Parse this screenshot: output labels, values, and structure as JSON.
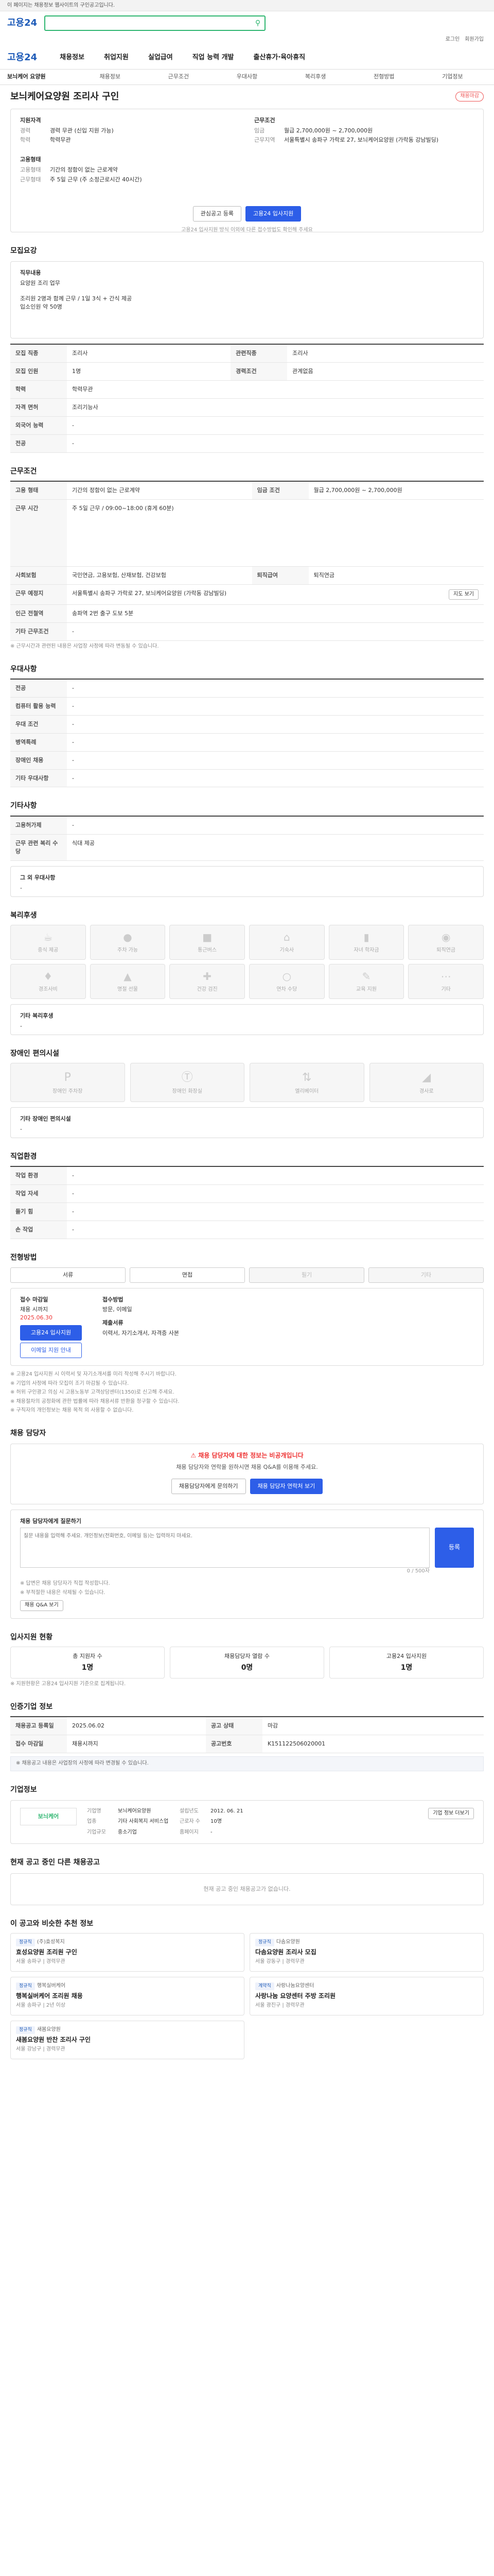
{
  "topbar": {
    "text": "이 페이지는 채용정보 웹사이트의 구인공고입니다."
  },
  "brand": {
    "logo": "고용24"
  },
  "util": [
    "로그인",
    "회원가입"
  ],
  "gnb": [
    "채용정보",
    "취업지원",
    "실업급여",
    "직업 능력 개발",
    "출산휴가·육아휴직"
  ],
  "tabs": [
    "채용정보",
    "근무조건",
    "우대사항",
    "복리후생",
    "전형방법",
    "기업정보"
  ],
  "job": {
    "company": "보늬케어 요양원",
    "title": "보늬케어요양원 조리사 구인",
    "badge": "채용마감",
    "left_label": "지원자격",
    "left_rows": [
      {
        "k": "경력",
        "v": "경력 무관 (신입 지원 가능)"
      },
      {
        "k": "학력",
        "v": "학력무관"
      }
    ],
    "right_label": "근무조건",
    "right_rows": [
      {
        "k": "임금",
        "v": "월급 2,700,000원 ~ 2,700,000원"
      },
      {
        "k": "근무지역",
        "v": "서울특별시 송파구 가락로 27, 보늬케어요양원 (가락동 강남빌딩)"
      }
    ],
    "left2_label": "고용형태",
    "left2_rows": [
      {
        "k": "고용형태",
        "v": "기간의 정함이 없는 근로계약"
      },
      {
        "k": "근무형태",
        "v": "주 5일 근무 (주 소정근로시간 40시간)"
      }
    ],
    "btn_scrap": "관심공고 등록",
    "btn_apply": "고용24 입사지원",
    "foot": "고용24 입사지원 방식 이외에 다른 접수방법도 확인해 주세요"
  },
  "summary": {
    "title": "모집요강",
    "duty_label": "직무내용",
    "duty": "요양원 조리 업무",
    "duty2": "조리원 2명과 함께 근무 / 1일 3식 + 간식 제공",
    "duty3": "입소인원 약 50명",
    "rows": [
      {
        "k": "모집 직종",
        "v": "조리사",
        "k2": "관련직종",
        "v2": "조리사"
      },
      {
        "k": "모집 인원",
        "v": "1명",
        "k2": "경력조건",
        "v2": "관계없음"
      },
      {
        "k": "학력",
        "v": "학력무관",
        "k2": "",
        "v2": ""
      },
      {
        "k": "자격 면허",
        "v": "조리기능사",
        "k2": "",
        "v2": ""
      },
      {
        "k": "외국어 능력",
        "v": "-",
        "k2": "",
        "v2": ""
      },
      {
        "k": "전공",
        "v": "-",
        "k2": "",
        "v2": ""
      }
    ]
  },
  "conditions": {
    "title": "근무조건",
    "rows": [
      {
        "k": "고용 형태",
        "v": "기간의 정함이 없는 근로계약",
        "k2": "임금 조건",
        "v2": "월급 2,700,000원 ~ 2,700,000원"
      },
      {
        "k": "근무 시간",
        "v": "주 5일 근무 / 09:00~18:00 (휴게 60분)",
        "k2": "",
        "v2": ""
      },
      {
        "k": "사회보험",
        "v": "국민연금, 고용보험, 산재보험, 건강보험",
        "k2": "퇴직급여",
        "v2": "퇴직연금"
      },
      {
        "k": "근무 예정지",
        "v": "서울특별시 송파구 가락로 27, 보늬케어요양원 (가락동 강남빌딩)",
        "k2": "",
        "v2": ""
      },
      {
        "k": "인근 전철역",
        "v": "송파역 2번 출구 도보 5분",
        "k2": "",
        "v2": ""
      },
      {
        "k": "기타 근무조건",
        "v": "-",
        "k2": "",
        "v2": ""
      }
    ],
    "map_btn": "지도 보기",
    "note": "※ 근무시간과 관련된 내용은 사업장 사정에 따라 변동될 수 있습니다."
  },
  "preference": {
    "title": "우대사항",
    "rows": [
      {
        "k": "전공",
        "v": "-"
      },
      {
        "k": "컴퓨터 활용 능력",
        "v": "-"
      },
      {
        "k": "우대 조건",
        "v": "-"
      },
      {
        "k": "병역특례",
        "v": "-"
      },
      {
        "k": "장애인 채용",
        "v": "-"
      },
      {
        "k": "기타 우대사항",
        "v": "-"
      }
    ]
  },
  "etc": {
    "title": "기타사항",
    "rows": [
      {
        "k": "고용허가제",
        "v": "-"
      },
      {
        "k": "근무 관련 복리 수당",
        "v": "식대 제공"
      }
    ],
    "extra_label": "그 외 우대사항",
    "extra": "-"
  },
  "welfare": {
    "title": "복리후생",
    "tiles": [
      "중식 제공",
      "주차 가능",
      "통근버스",
      "기숙사",
      "자녀 학자금",
      "퇴직연금",
      "경조사비",
      "명절 선물",
      "건강 검진",
      "연차 수당",
      "교육 지원",
      "기타"
    ],
    "extra_label": "기타 복리후생",
    "extra": "-"
  },
  "disabled": {
    "title": "장애인 편의시설",
    "tiles": [
      "장애인 주차장",
      "장애인 화장실",
      "엘리베이터",
      "경사로"
    ],
    "extra_label": "기타 장애인 편의시설",
    "extra": "-"
  },
  "worktype": {
    "title": "직업환경",
    "rows": [
      {
        "k": "작업 환경",
        "v": "-",
        "k2": "",
        "v2": ""
      },
      {
        "k": "작업 자세",
        "v": "-",
        "k2": "",
        "v2": ""
      },
      {
        "k": "들기 힘",
        "v": "-",
        "k2": "",
        "v2": ""
      },
      {
        "k": "손 작업",
        "v": "-",
        "k2": "",
        "v2": ""
      }
    ]
  },
  "selection": {
    "title": "전형방법",
    "pills": [
      "서류",
      "면접",
      "필기",
      "기타"
    ],
    "apply_label": "접수 마감일",
    "apply_value": "채용 시까지",
    "apply_value2": "2025.06.30",
    "method_label": "접수방법",
    "method_value": "방문, 이메일",
    "docs_label": "제출서류",
    "docs_value": "이력서, 자기소개서, 자격증 사본",
    "btn_apply": "고용24 입사지원",
    "btn_mail": "이메일 지원 안내",
    "bullets": [
      "※ 고용24 입사지원 시 이력서 및 자기소개서를 미리 작성해 주시기 바랍니다.",
      "※ 기업의 사정에 따라 모집이 조기 마감될 수 있습니다.",
      "※ 허위 구인광고 의심 시 고용노동부 고객상담센터(1350)로 신고해 주세요.",
      "※ 채용절차의 공정화에 관한 법률에 따라 채용서류 반환을 청구할 수 있습니다.",
      "※ 구직자의 개인정보는 채용 목적 외 사용할 수 없습니다."
    ]
  },
  "contact": {
    "title": "채용 담당자",
    "headline": "채용 담당자에 대한 정보는 비공개입니다",
    "sub": "채용 담당자와 연락을 원하시면 채용 Q&A를 이용해 주세요.",
    "btn1": "채용담당자에게 문의하기",
    "btn2": "채용 담당자 연락처 보기",
    "qa_label": "채용 담당자에게 질문하기",
    "qa_placeholder": "질문 내용을 입력해 주세요. 개인정보(전화번호, 이메일 등)는 입력하지 마세요.",
    "qa_count": "0 / 500자",
    "qa_btn": "등록",
    "notes": [
      "※ 답변은 채용 담당자가 직접 작성합니다.",
      "※ 부적절한 내용은 삭제될 수 있습니다."
    ],
    "qa_link": "채용 Q&A 보기"
  },
  "stats": {
    "title": "입사지원 현황",
    "items": [
      {
        "k": "총 지원자 수",
        "v": "1명"
      },
      {
        "k": "채용담당자 열람 수",
        "v": "0명"
      },
      {
        "k": "고용24 입사지원",
        "v": "1명"
      }
    ],
    "note": "※ 지원현황은 고용24 입사지원 기준으로 집계됩니다."
  },
  "info": {
    "title": "인증기업 정보",
    "rows": [
      {
        "k": "채용공고 등록일",
        "v": "2025.06.02",
        "k2": "공고 상태",
        "v2": "마감"
      },
      {
        "k": "접수 마감일",
        "v": "채용시까지",
        "k2": "공고번호",
        "v2": "K151122506020001"
      }
    ],
    "notice": "※ 채용공고 내용은 사업장의 사정에 따라 변경될 수 있습니다."
  },
  "company": {
    "title": "기업정보",
    "logo": "보늬케어",
    "rows": [
      {
        "k": "기업명",
        "v": "보늬케어요양원"
      },
      {
        "k": "설립년도",
        "v": "2012. 06. 21"
      },
      {
        "k": "업종",
        "v": "기타 사회복지 서비스업"
      },
      {
        "k": "근로자 수",
        "v": "10명"
      },
      {
        "k": "기업규모",
        "v": "중소기업"
      },
      {
        "k": "홈페이지",
        "v": "-"
      }
    ],
    "btn": "기업 정보 더보기"
  },
  "similar": {
    "title": "현재 공고 중인 다른 채용공고",
    "empty": "현재 공고 중인 채용공고가 없습니다."
  },
  "recommend": {
    "title": "이 공고와 비슷한 추천 정보",
    "items": [
      {
        "co": "(주)효성복지",
        "tt": "효성요양원 조리원 구인",
        "meta": "서울 송파구 | 경력무관",
        "tag": "정규직"
      },
      {
        "co": "다솜요양원",
        "tt": "다솜요양원 조리사 모집",
        "meta": "서울 강동구 | 경력무관",
        "tag": "정규직"
      },
      {
        "co": "행복실버케어",
        "tt": "행복실버케어 조리원 채용",
        "meta": "서울 송파구 | 2년 이상",
        "tag": "정규직"
      },
      {
        "co": "사랑나눔요양센터",
        "tt": "사랑나눔 요양센터 주방 조리원",
        "meta": "서울 광진구 | 경력무관",
        "tag": "계약직"
      },
      {
        "co": "새봄요양원",
        "tt": "새봄요양원 반찬 조리사 구인",
        "meta": "서울 강남구 | 경력무관",
        "tag": "정규직"
      }
    ]
  }
}
